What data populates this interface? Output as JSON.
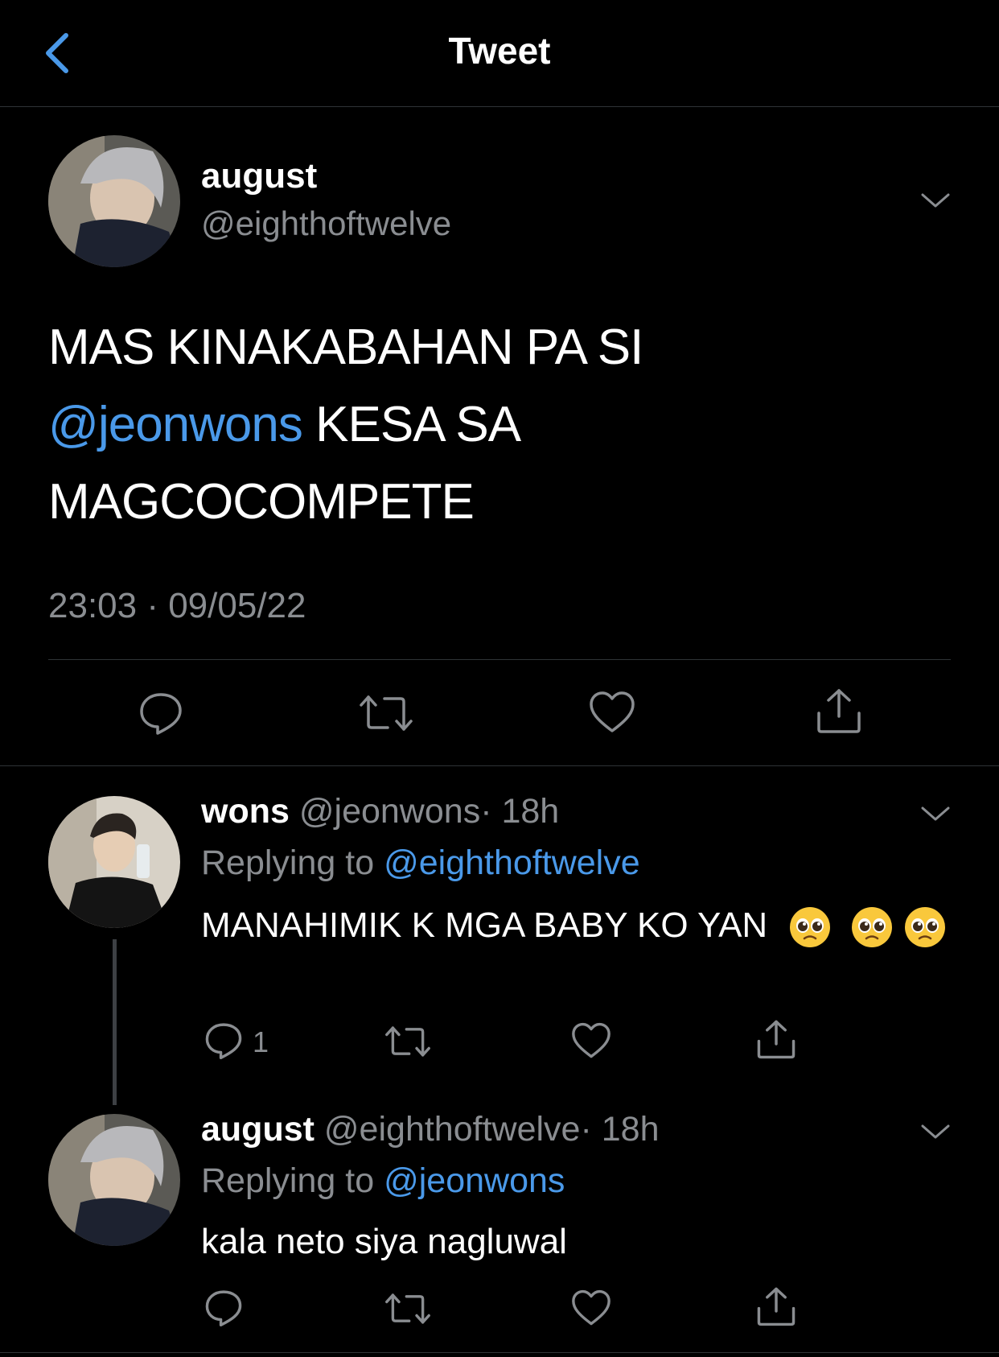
{
  "header": {
    "title": "Tweet",
    "back_icon": "chevron-left-icon"
  },
  "main_tweet": {
    "name": "august",
    "handle": "@eighthoftwelve",
    "text_line1": "MAS KINAKABAHAN PA SI",
    "mention": "@jeonwons",
    "text_line2_rest": " KESA SA",
    "text_line3": "MAGCOCOMPETE",
    "timestamp": "23:03 · 09/05/22"
  },
  "replies": [
    {
      "name": "wons",
      "handle": "@jeonwons",
      "time": "· 18h",
      "replying_label": "Replying to ",
      "replying_to": "@eighthoftwelve",
      "text": "MANAHIMIK K MGA BABY KO YAN",
      "emoji": "pleading-face-emoji",
      "reply_count": "1"
    },
    {
      "name": "august",
      "handle": "@eighthoftwelve",
      "time": "· 18h",
      "replying_label": "Replying to ",
      "replying_to": "@jeonwons",
      "text": "kala neto siya nagluwal"
    }
  ],
  "colors": {
    "background": "#000000",
    "link": "#4a99e9",
    "muted": "#8a8d91",
    "divider": "#2f3336"
  }
}
